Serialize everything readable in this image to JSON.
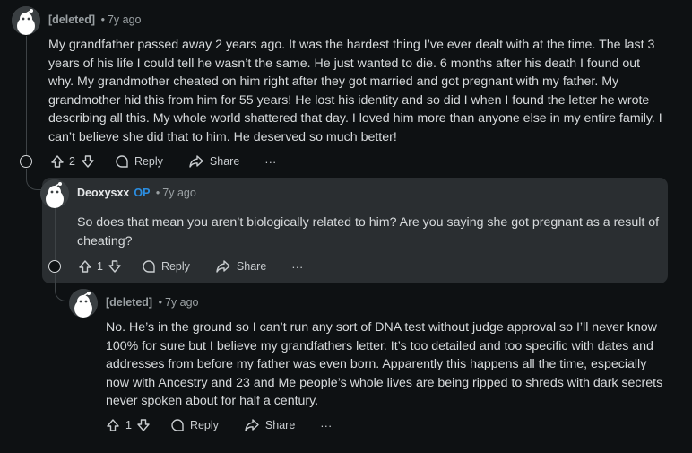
{
  "comments": [
    {
      "author": "[deleted]",
      "time": "7y ago",
      "body": "My grandfather passed away 2 years ago. It was the hardest thing I’ve ever dealt with at the time. The last 3 years of his life I could tell he wasn’t the same. He just wanted to die. 6 months after his death I found out why. My grandmother cheated on him right after they got married and got pregnant with my father. My grandmother hid this from him for 55 years! He lost his identity and so did I when I found the letter he wrote describing all this. My whole world shattered that day. I loved him more than anyone else in my entire family. I can’t believe she did that to him. He deserved so much better!",
      "score": "2",
      "reply_label": "Reply",
      "share_label": "Share",
      "more_label": "···"
    },
    {
      "author": "Deoxysxx",
      "op_badge": "OP",
      "time": "7y ago",
      "body": "So does that mean you aren’t biologically related to him? Are you saying she got pregnant as a result of cheating?",
      "score": "1",
      "reply_label": "Reply",
      "share_label": "Share",
      "more_label": "···"
    },
    {
      "author": "[deleted]",
      "time": "7y ago",
      "body": "No. He’s in the ground so I can’t run any sort of DNA test without judge approval so I’ll never know 100% for sure but I believe my grandfathers letter. It’s too detailed and too specific with dates and addresses from before my father was even born. Apparently this happens all the time, especially now with Ancestry and 23 and Me people’s whole lives are being ripped to shreds with dark secrets never spoken about for half a century.",
      "score": "1",
      "reply_label": "Reply",
      "share_label": "Share",
      "more_label": "···"
    }
  ],
  "colors": {
    "background": "#0e1113",
    "highlight": "#2a2e31",
    "op_badge": "#2b8de0",
    "text": "#d7dadc",
    "meta": "#9aa0a3"
  },
  "icons": [
    "snoo-avatar-icon",
    "upvote-icon",
    "downvote-icon",
    "reply-bubble-icon",
    "share-arrow-icon",
    "more-options-icon",
    "collapse-thread-icon"
  ]
}
